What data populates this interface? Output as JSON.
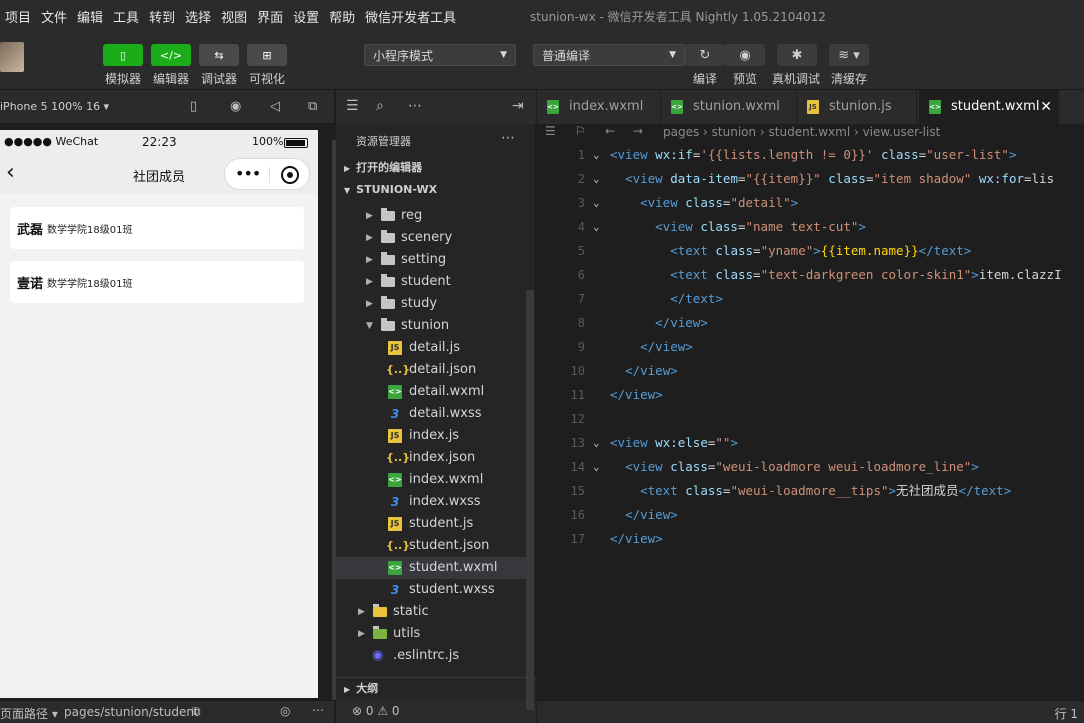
{
  "menu": [
    "项目",
    "文件",
    "编辑",
    "工具",
    "转到",
    "选择",
    "视图",
    "界面",
    "设置",
    "帮助",
    "微信开发者工具"
  ],
  "window_title": "stunion-wx - 微信开发者工具 Nightly 1.05.2104012",
  "toolbar": {
    "simulator": "模拟器",
    "editor": "编辑器",
    "debugger": "调试器",
    "visual": "可视化",
    "mode": "小程序模式",
    "compile_mode": "普通编译",
    "compile": "编译",
    "preview": "预览",
    "real_debug": "真机调试",
    "clear_cache": "清缓存"
  },
  "sim": {
    "device": "iPhone 5 100% 16 ▾",
    "status_left": "●●●●● WeChat",
    "time": "22:23",
    "battery": "100%",
    "nav_title": "社团成员",
    "members": [
      {
        "name": "武磊",
        "clazz": "数学学院18级01班"
      },
      {
        "name": "壹诺",
        "clazz": "数学学院18级01班"
      }
    ],
    "footer_path_label": "页面路径 ▾",
    "footer_path": "pages/stunion/student"
  },
  "explorer": {
    "title": "资源管理器",
    "open_editors": "打开的编辑器",
    "project": "STUNION-WX",
    "folders_top": [
      "reg",
      "scenery",
      "setting",
      "student",
      "study",
      "stunion"
    ],
    "files": [
      {
        "name": "detail.js",
        "type": "js"
      },
      {
        "name": "detail.json",
        "type": "json"
      },
      {
        "name": "detail.wxml",
        "type": "wxml"
      },
      {
        "name": "detail.wxss",
        "type": "wxss"
      },
      {
        "name": "index.js",
        "type": "js"
      },
      {
        "name": "index.json",
        "type": "json"
      },
      {
        "name": "index.wxml",
        "type": "wxml"
      },
      {
        "name": "index.wxss",
        "type": "wxss"
      },
      {
        "name": "student.js",
        "type": "js"
      },
      {
        "name": "student.json",
        "type": "json"
      },
      {
        "name": "student.wxml",
        "type": "wxml"
      },
      {
        "name": "student.wxss",
        "type": "wxss"
      }
    ],
    "folders_bottom": [
      "static",
      "utils"
    ],
    "eslint": ".eslintrc.js",
    "outline": "大纲",
    "status": "⊗ 0 ⚠ 0"
  },
  "tabs": [
    "index.wxml",
    "stunion.wxml",
    "stunion.js",
    "student.wxml"
  ],
  "breadcrumb": "pages › stunion › student.wxml › view.user-list",
  "code": [
    "<view wx:if='{{lists.length != 0}}' class=\"user-list\">",
    "  <view data-item=\"{{item}}\" class=\"item shadow\" wx:for=\"{{lis",
    "    <view class=\"detail\">",
    "      <view class=\"name text-cut\">",
    "        <text class=\"yname\">{{item.name}}</text>",
    "        <text class=\"text-darkgreen color-skin1\">{{item.clazzI",
    "        </text>",
    "      </view>",
    "    </view>",
    "  </view>",
    "</view>",
    "",
    "<view wx:else=\"\">",
    "  <view class=\"weui-loadmore weui-loadmore_line\">",
    "    <text class=\"weui-loadmore__tips\">无社团成员</text>",
    "  </view>",
    "</view>"
  ],
  "status_right": "行 1"
}
